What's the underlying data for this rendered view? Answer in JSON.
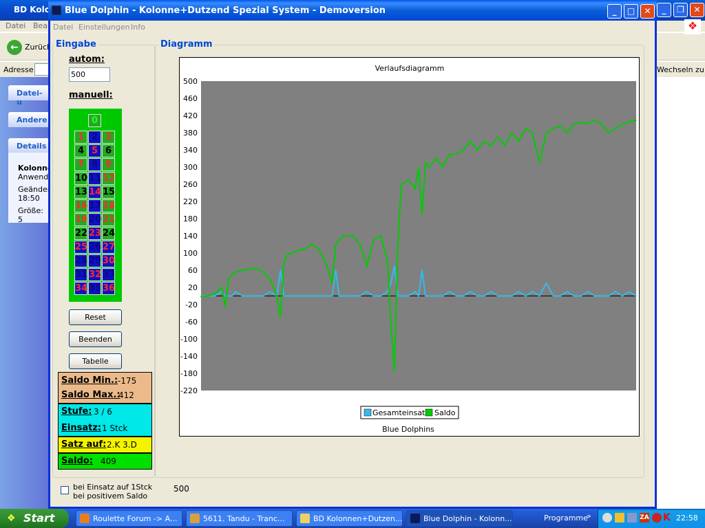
{
  "bg_window": {
    "title": "BD Kolo",
    "menu": [
      "Datei",
      "Bea"
    ],
    "back_label": "Zurück",
    "address_label": "Adresse",
    "wechseln": "Wechseln zu",
    "panels": [
      "Datei- u",
      "Andere",
      "Details"
    ],
    "details": {
      "name": "Kolonne",
      "type": "Anwendu",
      "changed_label": "Geänder",
      "changed_time": "18:50",
      "size": "Größe: 5"
    }
  },
  "window": {
    "title": "Blue Dolphin -  Kolonne+Dutzend Spezial System - Demoversion",
    "menu": [
      "Datei",
      "Einstellungen",
      "Info"
    ]
  },
  "eingabe": {
    "group_label": "Eingabe",
    "autom_label": "autom:",
    "autom_value": "500",
    "manuell_label": "manuell:"
  },
  "roulette": {
    "zero": "0",
    "rows": [
      [
        "1",
        "2",
        "3"
      ],
      [
        "4",
        "5",
        "6"
      ],
      [
        "7",
        "8",
        "9"
      ],
      [
        "10",
        "11",
        "12"
      ],
      [
        "13",
        "14",
        "15"
      ],
      [
        "16",
        "17",
        "18"
      ],
      [
        "19",
        "20",
        "21"
      ],
      [
        "22",
        "23",
        "24"
      ],
      [
        "25",
        "26",
        "27"
      ],
      [
        "28",
        "29",
        "30"
      ],
      [
        "31",
        "32",
        "33"
      ],
      [
        "34",
        "35",
        "36"
      ]
    ],
    "colors": {
      "red": "#ff2a2a",
      "black": "#000000",
      "dark_red": "#cc2020",
      "green_cell": "#22aa22",
      "blue_cell": "#1010c8"
    }
  },
  "buttons": {
    "reset": "Reset",
    "beenden": "Beenden",
    "tabelle": "Tabelle"
  },
  "stats": {
    "saldo_min_label": "Saldo Min.:",
    "saldo_min": "-175",
    "saldo_max_label": "Saldo Max.:",
    "saldo_max": "412",
    "stufe_label": "Stufe:",
    "stufe": "3 / 6",
    "einsatz_label": "Einsatz:",
    "einsatz": "1 Stck",
    "satz_label": "Satz auf:",
    "satz": "2.K 3.D",
    "saldo_label": "Saldo:",
    "saldo": "409",
    "colors": {
      "minmax": "#ecba8a",
      "stufe": "#00e8e8",
      "satz": "#f4f400",
      "saldo": "#00e000"
    }
  },
  "diagramm": {
    "group_label": "Diagramm"
  },
  "chart_data": {
    "type": "line",
    "title": "Verlaufsdiagramm",
    "footer": "Blue Dolphins",
    "ylim": [
      -220,
      500
    ],
    "yticks": [
      500,
      460,
      420,
      380,
      340,
      300,
      260,
      220,
      180,
      140,
      100,
      60,
      20,
      -20,
      -60,
      -100,
      -140,
      -180,
      -220
    ],
    "grid": false,
    "legend_position": "bottom",
    "x": [
      0,
      10,
      20,
      30,
      35,
      40,
      45,
      50,
      60,
      70,
      80,
      90,
      100,
      110,
      115,
      120,
      125,
      130,
      140,
      150,
      160,
      170,
      180,
      190,
      195,
      200,
      205,
      210,
      220,
      230,
      240,
      250,
      260,
      270,
      275,
      280,
      285,
      290,
      300,
      310,
      315,
      320,
      325,
      330,
      340,
      350,
      360,
      370,
      380,
      390,
      400,
      410,
      420,
      430,
      440,
      450,
      460,
      470,
      480,
      490,
      500,
      510,
      520,
      530,
      540,
      550,
      560,
      570,
      580,
      590,
      600,
      610,
      620,
      630
    ],
    "series": [
      {
        "name": "Saldo",
        "color": "#00cc00",
        "values": [
          -2,
          0,
          5,
          20,
          -25,
          40,
          50,
          55,
          60,
          62,
          65,
          55,
          40,
          0,
          -50,
          80,
          95,
          100,
          105,
          110,
          120,
          110,
          80,
          30,
          120,
          130,
          140,
          140,
          140,
          120,
          70,
          130,
          140,
          80,
          -70,
          -175,
          120,
          260,
          270,
          250,
          300,
          190,
          310,
          300,
          320,
          300,
          330,
          330,
          340,
          360,
          340,
          360,
          350,
          370,
          350,
          380,
          360,
          390,
          380,
          310,
          380,
          390,
          395,
          380,
          400,
          405,
          400,
          410,
          400,
          380,
          390,
          400,
          405,
          409
        ]
      },
      {
        "name": "Gesamteinsatz",
        "color": "#33bbee",
        "values": [
          0,
          0,
          0,
          10,
          0,
          0,
          0,
          10,
          0,
          0,
          0,
          0,
          10,
          0,
          60,
          0,
          0,
          0,
          0,
          0,
          0,
          0,
          0,
          0,
          60,
          0,
          0,
          0,
          0,
          0,
          10,
          0,
          0,
          10,
          30,
          70,
          0,
          0,
          0,
          10,
          0,
          60,
          0,
          0,
          0,
          0,
          10,
          0,
          0,
          10,
          0,
          0,
          10,
          0,
          0,
          0,
          10,
          0,
          10,
          0,
          30,
          0,
          0,
          10,
          0,
          0,
          10,
          0,
          0,
          0,
          10,
          0,
          10,
          0
        ]
      }
    ],
    "zero_line_color": "#000000",
    "plot_bg": "#808080"
  },
  "bottom": {
    "checkbox_line1": "bei Einsatz auf 1Stck",
    "checkbox_line2": "bei positivem Saldo",
    "value": "500"
  },
  "taskbar": {
    "start": "Start",
    "tasks": [
      "Roulette Forum -> A...",
      "5611. Tandu  - Tranc...",
      "BD Kolonnen+Dutzen...",
      "Blue Dolphin - Kolonn..."
    ],
    "programme": "Programme",
    "clock": "22:58"
  }
}
